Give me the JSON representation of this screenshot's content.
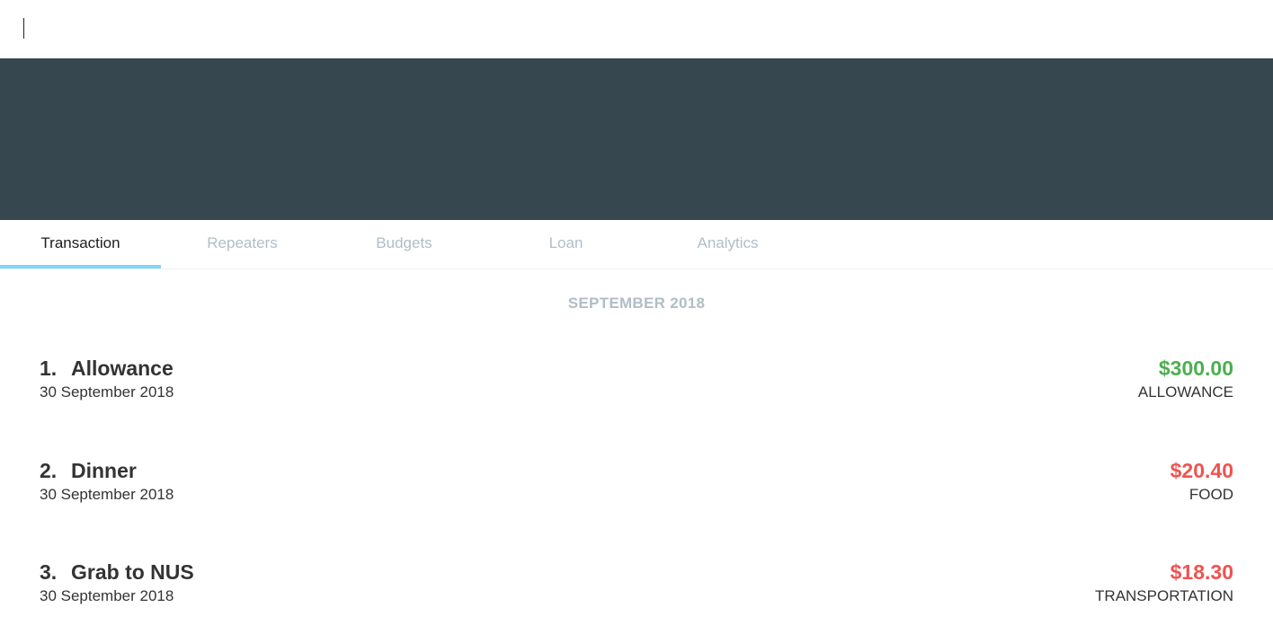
{
  "tabs": [
    {
      "label": "Transaction",
      "active": true
    },
    {
      "label": "Repeaters",
      "active": false
    },
    {
      "label": "Budgets",
      "active": false
    },
    {
      "label": "Loan",
      "active": false
    },
    {
      "label": "Analytics",
      "active": false
    }
  ],
  "month_header": "SEPTEMBER 2018",
  "transactions": [
    {
      "index": "1.",
      "name": "Allowance",
      "date": "30 September 2018",
      "amount": "$300.00",
      "category": "ALLOWANCE",
      "type": "income"
    },
    {
      "index": "2.",
      "name": "Dinner",
      "date": "30 September 2018",
      "amount": "$20.40",
      "category": "FOOD",
      "type": "expense"
    },
    {
      "index": "3.",
      "name": "Grab to NUS",
      "date": "30 September 2018",
      "amount": "$18.30",
      "category": "TRANSPORTATION",
      "type": "expense"
    }
  ],
  "colors": {
    "banner": "#37474f",
    "income": "#4caf50",
    "expense": "#ef5350",
    "tab_indicator": "#81d4fa",
    "muted": "#b0bec5"
  }
}
